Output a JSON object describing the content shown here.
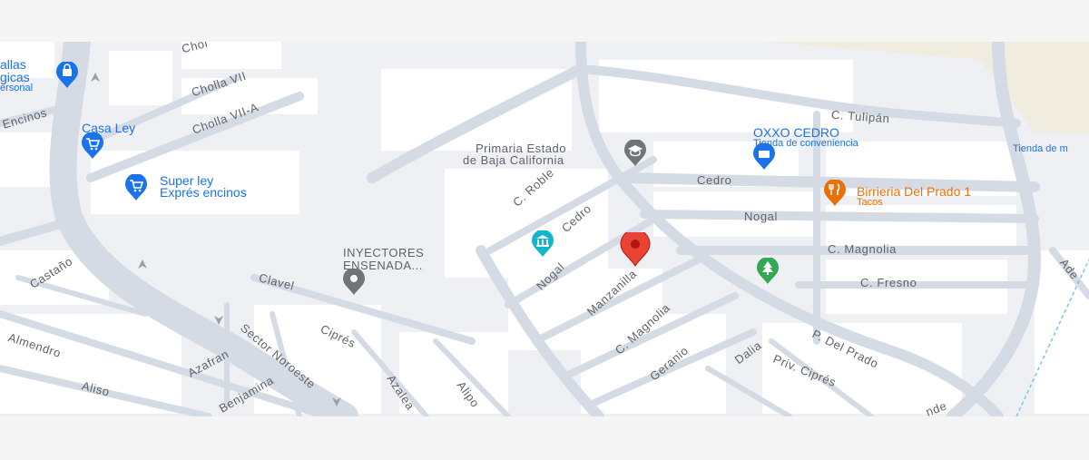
{
  "map": {
    "streets": {
      "cholla": "Chol",
      "cholla_vii": "Cholla VII",
      "cholla_vii_a": "Cholla VII-A",
      "encinos": "Encinos",
      "castano": "Castaño",
      "almendro": "Almendro",
      "azafran": "Azafran",
      "aliso": "Aliso",
      "benjamina": "Benjamina",
      "sector_noroeste": "Sector Noroeste",
      "clavel": "Clavel",
      "cipres": "Ciprés",
      "azalea": "Azalea",
      "alipo": "Alipo",
      "c_roble": "C. Roble",
      "cedro_diag": "Cedro",
      "nogal_diag": "Nogal",
      "manzanilla": "Manzanilla",
      "c_magnolia_diag": "C. Magnolia",
      "geranio": "Geranio",
      "dalia": "Dalia",
      "priv_cipres": "Priv. Ciprés",
      "p_del_prado": "P. Del Prado",
      "cedro": "Cedro",
      "nogal": "Nogal",
      "c_magnolia": "C. Magnolia",
      "c_fresno": "C. Fresno",
      "c_tulipan": "C. Tulipán",
      "ade": "Ade",
      "nde": "nde"
    },
    "pois": {
      "fallas_line1": "allas",
      "fallas_line2": "gicas",
      "fallas_line3": "ersonal",
      "casa_ley": "Casa Ley",
      "super_ley_line1": "Super ley",
      "super_ley_line2": "Exprés encinos",
      "primaria_line1": "Primaria Estado",
      "primaria_line2": "de Baja California",
      "inyectores_line1": "INYECTORES",
      "inyectores_line2": "ENSENADA...",
      "oxxo_name": "OXXO CEDRO",
      "oxxo_category": "Tienda de conveniencia",
      "tienda_de": "Tienda de m",
      "birrieria_name": "Birrieria Del Prado 1",
      "birrieria_category": "Tacos"
    },
    "icons": {
      "selected_pin": "red-location-pin",
      "school": "school-pin",
      "shopping": "shopping-bag-pin",
      "cart": "shopping-cart-pin",
      "restaurant": "restaurant-pin",
      "park": "park-tree-pin",
      "landmark": "landmark-pin",
      "generic": "gray-place-pin"
    },
    "colors": {
      "road": "#d5dbe4",
      "block": "#ffffff",
      "background": "#eef0f3",
      "sand": "#f1ece0",
      "pin_red": "#ea4335",
      "poi_blue": "#1a73e8",
      "poi_orange": "#e8710a",
      "park_green": "#34a853",
      "landmark_teal": "#12b5cb",
      "gray_pin": "#70757a"
    }
  }
}
